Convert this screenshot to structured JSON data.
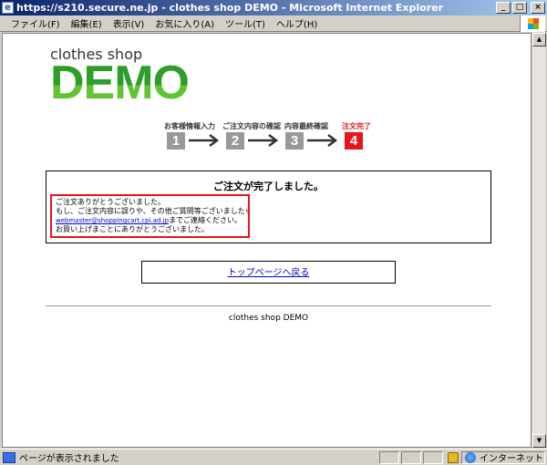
{
  "window": {
    "title": "https://s210.secure.ne.jp - clothes shop DEMO - Microsoft Internet Explorer",
    "minimize": "_",
    "maximize": "□",
    "close": "×"
  },
  "menu": {
    "items": [
      "ファイル(F)",
      "編集(E)",
      "表示(V)",
      "お気に入り(A)",
      "ツール(T)",
      "ヘルプ(H)"
    ]
  },
  "page": {
    "logo_small": "clothes shop",
    "logo_big": "DEMO",
    "steps": [
      {
        "label": "お客様情報入力",
        "number": "1",
        "active": false
      },
      {
        "label": "ご注文内容の確認",
        "number": "2",
        "active": false
      },
      {
        "label": "内容最終確認",
        "number": "3",
        "active": false
      },
      {
        "label": "注文完了",
        "number": "4",
        "active": true
      }
    ],
    "complete_title": "ご注文が完了しました。",
    "message_lines": [
      "ご注文ありがとうございました。",
      "もし、ご注文内容に誤りや、その他ご質問等ございましたら"
    ],
    "email_link": "webmaster@shoppingcart.cpi.ad.jp",
    "email_suffix": "までご連絡ください。",
    "message_closing": "お買い上げまことにありがとうございました。",
    "top_link": "トップページへ戻る",
    "footer": "clothes shop DEMO"
  },
  "status": {
    "text": "ページが表示されました",
    "zone": "インターネット"
  },
  "colors": {
    "accent_red": "#e8141c",
    "logo_green": "#2e9e2a",
    "step_gray": "#999999",
    "titlebar_blue": "#0a246a"
  }
}
